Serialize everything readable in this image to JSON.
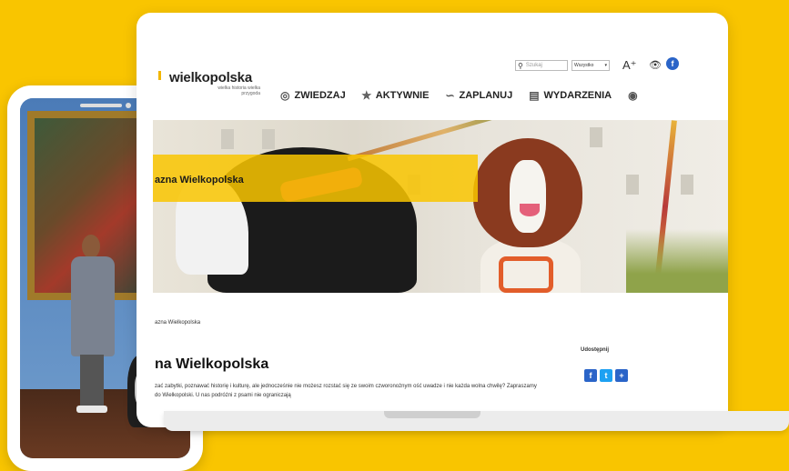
{
  "site": {
    "logo": "wielkopolska",
    "logo_tagline": "wielka historia wielka przygoda",
    "search_placeholder": "Szukaj",
    "search_scope": "Wszystko",
    "font_size_label": "A⁺"
  },
  "nav": {
    "items": [
      {
        "label": "ZWIEDZAJ"
      },
      {
        "label": "AKTYWNIE"
      },
      {
        "label": "ZAPLANUJ"
      },
      {
        "label": "WYDARZENIA"
      }
    ]
  },
  "hero": {
    "title": "azna Wielkopolska"
  },
  "breadcrumb": "azna Wielkopolska",
  "share": {
    "label": "Udostępnij"
  },
  "article": {
    "title": "na Wielkopolska",
    "body": "zać zabytki, poznawać historię i kulturę, ale jednocześnie nie możesz rozstać się ze swoim czworonożnym ość uwadze i nie każda wolna chwilę? Zapraszamy do Wielkopolski. U nas podróżni z psami nie ograniczają"
  },
  "colors": {
    "brand_yellow": "#f9c500",
    "facebook_blue": "#2a64c8",
    "twitter_blue": "#1da1f2"
  }
}
